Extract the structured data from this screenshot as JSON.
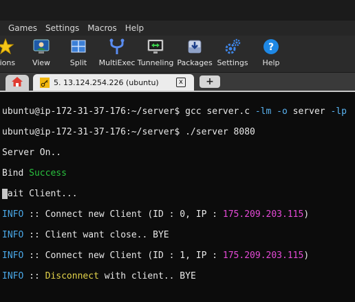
{
  "menu": [
    "Games",
    "Settings",
    "Macros",
    "Help"
  ],
  "toolbar": [
    {
      "label": "sions",
      "icon": "star-icon"
    },
    {
      "label": "View",
      "icon": "monitor-user-icon"
    },
    {
      "label": "Split",
      "icon": "split-grid-icon"
    },
    {
      "label": "MultiExec",
      "icon": "multiexec-fork-icon"
    },
    {
      "label": "Tunneling",
      "icon": "tunneling-icon"
    },
    {
      "label": "Packages",
      "icon": "packages-icon"
    },
    {
      "label": "Settings",
      "icon": "gears-icon"
    },
    {
      "label": "Help",
      "icon": "help-icon"
    }
  ],
  "tabs": {
    "session_title": "5. 13.124.254.226 (ubuntu)",
    "close_label": "x",
    "new_tab_label": "+"
  },
  "terminal": {
    "line1": {
      "prompt": "ubuntu@ip-172-31-37-176:~/server$ ",
      "cmd": "gcc server.c ",
      "flag1": "-lm",
      "mid": " ",
      "flag2": "-o",
      "rest": " server ",
      "flag3": "-lp"
    },
    "line2": {
      "prompt": "ubuntu@ip-172-31-37-176:~/server$ ",
      "cmd": "./server 8080"
    },
    "line3": "Server On..",
    "line4": {
      "text": "Bind ",
      "highlight": "Success"
    },
    "line5": "Wait Client...",
    "line6": {
      "tag": "INFO",
      "text": " :: Connect new Client (ID : 0, IP : ",
      "ip": "175.209.203.115",
      "end": ")"
    },
    "line7": {
      "tag": "INFO",
      "text": " :: Client want close.. BYE"
    },
    "line8": {
      "tag": "INFO",
      "text": " :: Connect new Client (ID : 1, IP : ",
      "ip": "175.209.203.115",
      "end": ")"
    },
    "line9": {
      "tag": "INFO",
      "sep": " :: ",
      "warn": "Disconnect",
      "text": " with client.. BYE"
    }
  },
  "colors": {
    "background": "#0c0c0c",
    "success": "#29c13e",
    "info": "#4aa8e8",
    "ip": "#e64ad8",
    "warning": "#e3d34a"
  }
}
